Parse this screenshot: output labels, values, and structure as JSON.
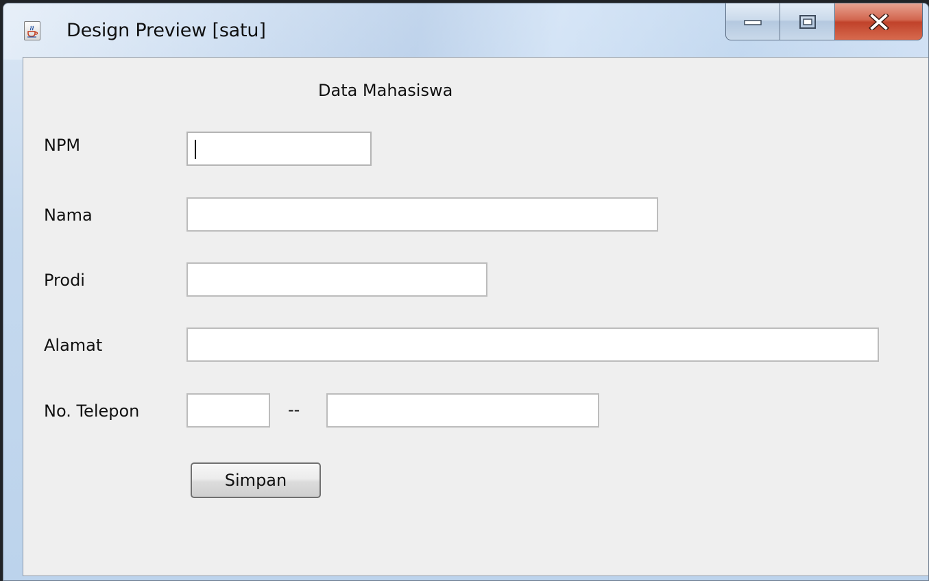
{
  "window": {
    "title": "Design Preview [satu]",
    "icon": "java-cup-icon",
    "caption_buttons": [
      "minimize-icon",
      "maximize-icon",
      "close-icon"
    ]
  },
  "form": {
    "title": "Data Mahasiswa",
    "fields": {
      "npm": {
        "label": "NPM",
        "value": ""
      },
      "nama": {
        "label": "Nama",
        "value": ""
      },
      "prodi": {
        "label": "Prodi",
        "value": ""
      },
      "alamat": {
        "label": "Alamat",
        "value": ""
      },
      "telepon": {
        "label": "No. Telepon",
        "area_code": "",
        "separator": "--",
        "number": ""
      }
    },
    "submit_label": "Simpan"
  },
  "colors": {
    "panel_bg": "#efefef",
    "close_button": "#c0422a",
    "titlebar": "#c5d9ee"
  }
}
